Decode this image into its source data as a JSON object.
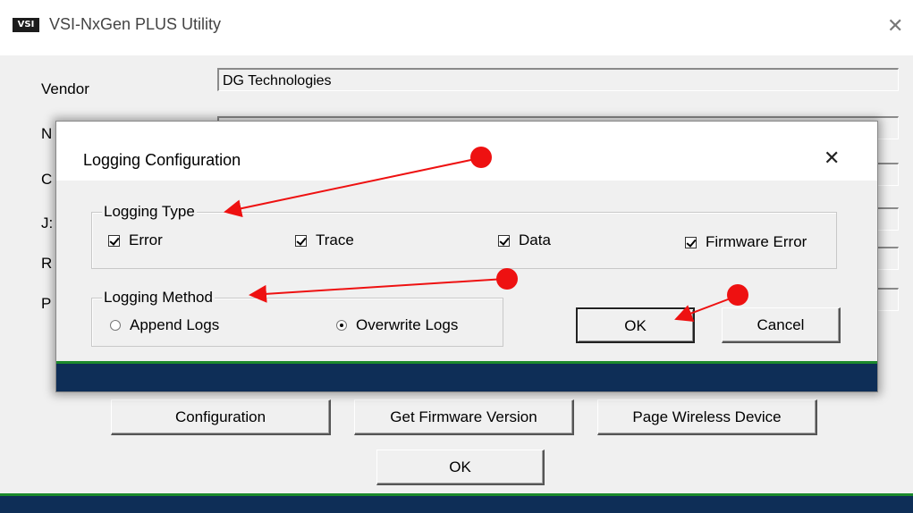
{
  "main_window": {
    "icon_text": "VSI",
    "title": "VSI-NxGen PLUS Utility",
    "close_glyph": "✕",
    "fields": [
      {
        "label": "Vendor",
        "value": "DG Technologies"
      },
      {
        "label": "N",
        "value": ""
      },
      {
        "label": "C",
        "value": ""
      },
      {
        "label": "J:",
        "value": ""
      },
      {
        "label": "R",
        "value": ""
      },
      {
        "label": "P",
        "value": ""
      }
    ],
    "buttons": {
      "configuration": "Configuration",
      "get_firmware_version": "Get Firmware Version",
      "page_wireless_device": "Page Wireless Device",
      "ok": "OK"
    }
  },
  "dialog": {
    "title": "Logging Configuration",
    "close_glyph": "✕",
    "logging_type": {
      "legend": "Logging Type",
      "options": [
        {
          "label": "Error",
          "checked": true
        },
        {
          "label": "Trace",
          "checked": true
        },
        {
          "label": "Data",
          "checked": true
        },
        {
          "label": "Firmware Error",
          "checked": true
        }
      ]
    },
    "logging_method": {
      "legend": "Logging Method",
      "options": [
        {
          "label": "Append Logs",
          "selected": false
        },
        {
          "label": "Overwrite Logs",
          "selected": true
        }
      ]
    },
    "buttons": {
      "ok": "OK",
      "cancel": "Cancel"
    }
  },
  "colors": {
    "annotation_red": "#ee1111",
    "status_bar_blue": "#0e2e57",
    "status_bar_green": "#1c8a2c"
  }
}
